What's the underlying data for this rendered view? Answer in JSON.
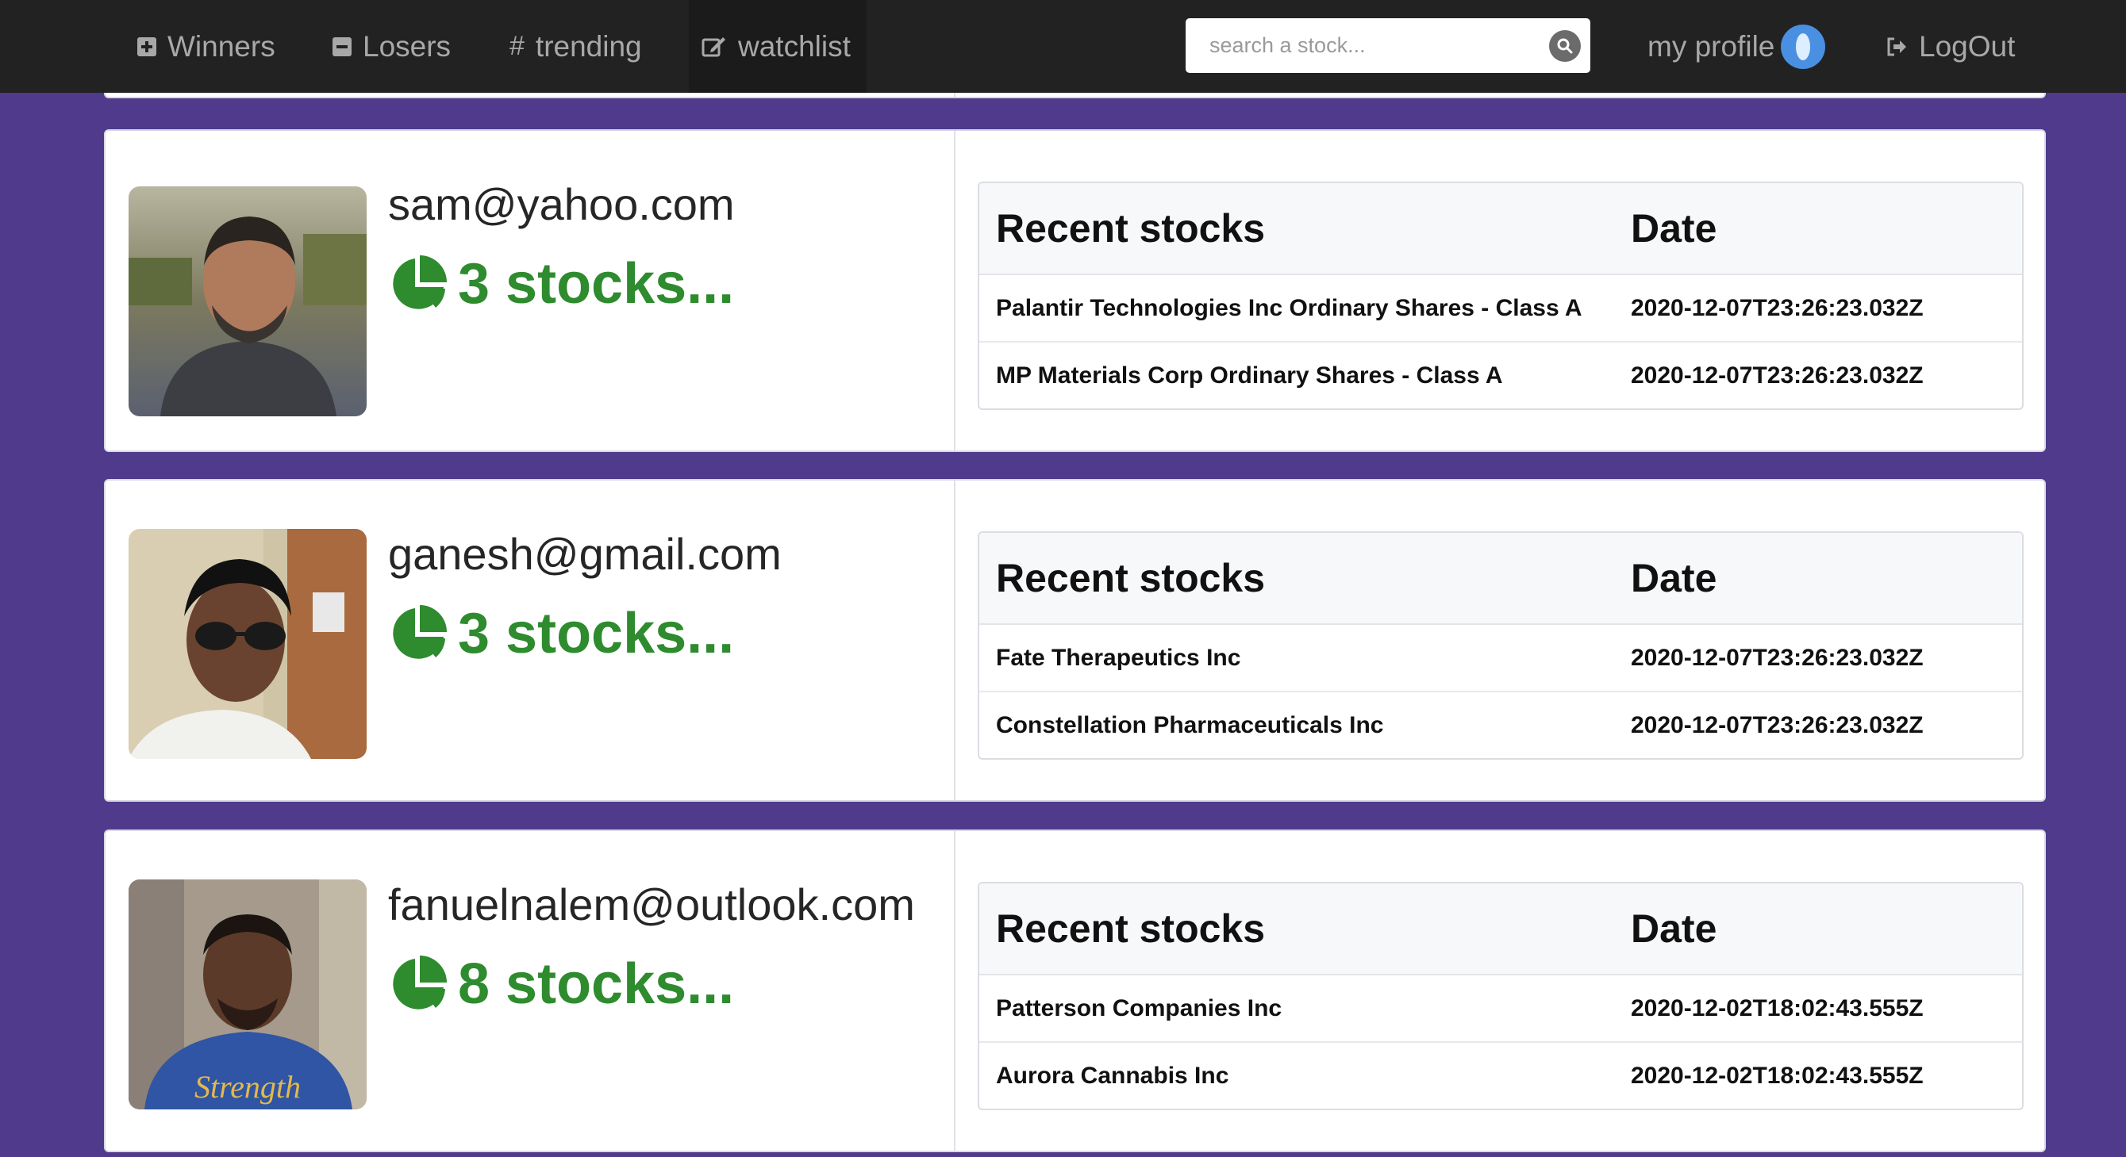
{
  "nav": {
    "winners": "Winners",
    "losers": "Losers",
    "trending": "trending",
    "watchlist": "watchlist",
    "search_placeholder": "search a stock...",
    "profile": "my profile",
    "logout": "LogOut"
  },
  "table_headers": {
    "stocks": "Recent stocks",
    "date": "Date"
  },
  "users": [
    {
      "email": "sam@yahoo.com",
      "stock_count": "3 stocks...",
      "recent": [
        {
          "name": "Palantir Technologies Inc Ordinary Shares - Class A",
          "date": "2020-12-07T23:26:23.032Z"
        },
        {
          "name": "MP Materials Corp Ordinary Shares - Class A",
          "date": "2020-12-07T23:26:23.032Z"
        }
      ]
    },
    {
      "email": "ganesh@gmail.com",
      "stock_count": "3 stocks...",
      "recent": [
        {
          "name": "Fate Therapeutics Inc",
          "date": "2020-12-07T23:26:23.032Z"
        },
        {
          "name": "Constellation Pharmaceuticals Inc",
          "date": "2020-12-07T23:26:23.032Z"
        }
      ]
    },
    {
      "email": "fanuelnalem@outlook.com",
      "stock_count": "8 stocks...",
      "recent": [
        {
          "name": "Patterson Companies Inc",
          "date": "2020-12-02T18:02:43.555Z"
        },
        {
          "name": "Aurora Cannabis Inc",
          "date": "2020-12-02T18:02:43.555Z"
        }
      ]
    }
  ]
}
